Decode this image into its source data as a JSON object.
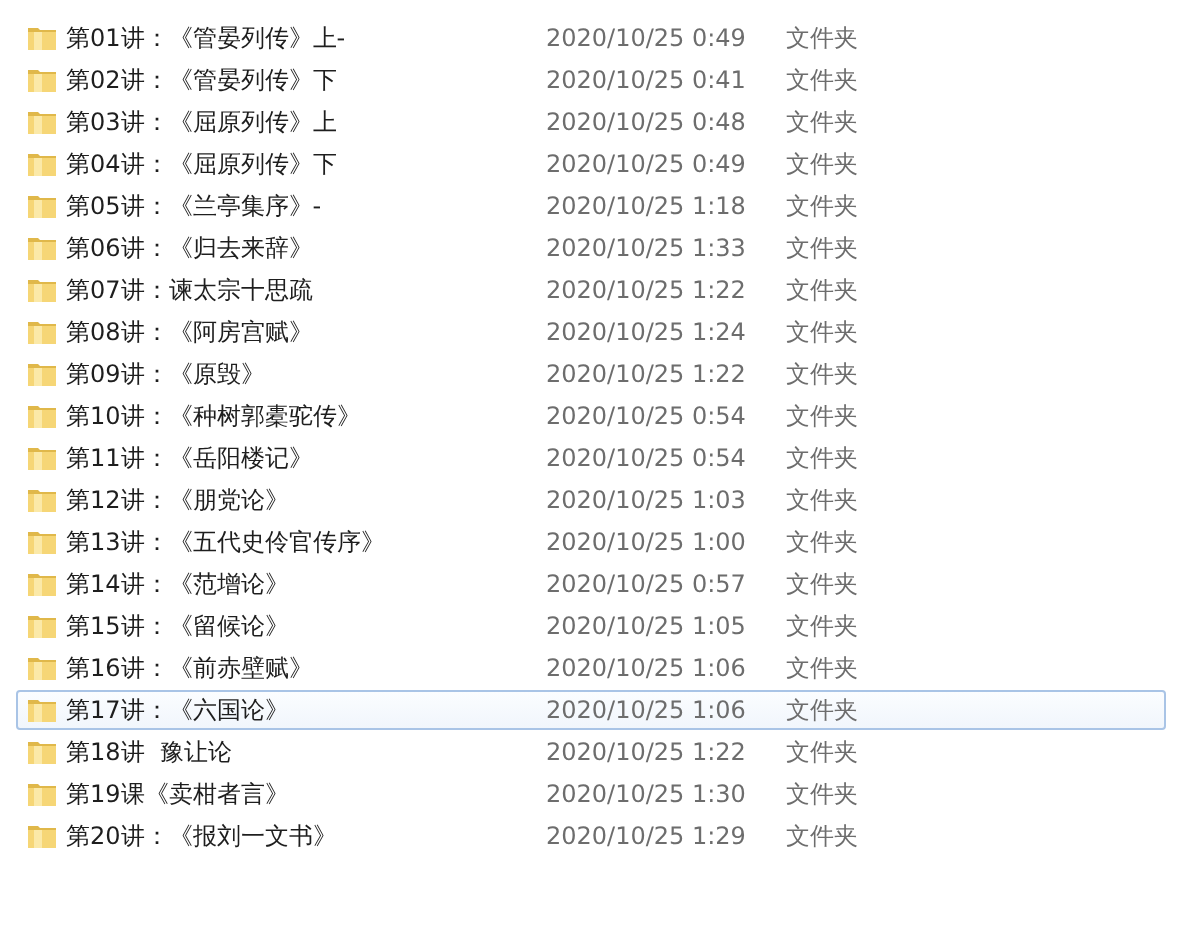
{
  "files": [
    {
      "name": "第01讲：《管晏列传》上-",
      "modified": "2020/10/25 0:49",
      "type": "文件夹",
      "selected": false
    },
    {
      "name": "第02讲：《管晏列传》下",
      "modified": "2020/10/25 0:41",
      "type": "文件夹",
      "selected": false
    },
    {
      "name": "第03讲：《屈原列传》上",
      "modified": "2020/10/25 0:48",
      "type": "文件夹",
      "selected": false
    },
    {
      "name": "第04讲：《屈原列传》下",
      "modified": "2020/10/25 0:49",
      "type": "文件夹",
      "selected": false
    },
    {
      "name": "第05讲：《兰亭集序》-",
      "modified": "2020/10/25 1:18",
      "type": "文件夹",
      "selected": false
    },
    {
      "name": "第06讲：《归去来辞》",
      "modified": "2020/10/25 1:33",
      "type": "文件夹",
      "selected": false
    },
    {
      "name": "第07讲：谏太宗十思疏",
      "modified": "2020/10/25 1:22",
      "type": "文件夹",
      "selected": false
    },
    {
      "name": "第08讲：《阿房宫赋》",
      "modified": "2020/10/25 1:24",
      "type": "文件夹",
      "selected": false
    },
    {
      "name": "第09讲：《原毁》",
      "modified": "2020/10/25 1:22",
      "type": "文件夹",
      "selected": false
    },
    {
      "name": "第10讲：《种树郭橐驼传》",
      "modified": "2020/10/25 0:54",
      "type": "文件夹",
      "selected": false
    },
    {
      "name": "第11讲：《岳阳楼记》",
      "modified": "2020/10/25 0:54",
      "type": "文件夹",
      "selected": false
    },
    {
      "name": "第12讲：《朋党论》",
      "modified": "2020/10/25 1:03",
      "type": "文件夹",
      "selected": false
    },
    {
      "name": "第13讲：《五代史伶官传序》",
      "modified": "2020/10/25 1:00",
      "type": "文件夹",
      "selected": false
    },
    {
      "name": "第14讲：《范增论》",
      "modified": "2020/10/25 0:57",
      "type": "文件夹",
      "selected": false
    },
    {
      "name": "第15讲：《留候论》",
      "modified": "2020/10/25 1:05",
      "type": "文件夹",
      "selected": false
    },
    {
      "name": "第16讲：《前赤壁赋》",
      "modified": "2020/10/25 1:06",
      "type": "文件夹",
      "selected": false
    },
    {
      "name": "第17讲：《六国论》",
      "modified": "2020/10/25 1:06",
      "type": "文件夹",
      "selected": true
    },
    {
      "name": "第18讲  豫让论",
      "modified": "2020/10/25 1:22",
      "type": "文件夹",
      "selected": false
    },
    {
      "name": "第19课《卖柑者言》",
      "modified": "2020/10/25 1:30",
      "type": "文件夹",
      "selected": false
    },
    {
      "name": "第20讲：《报刘一文书》",
      "modified": "2020/10/25 1:29",
      "type": "文件夹",
      "selected": false
    }
  ]
}
